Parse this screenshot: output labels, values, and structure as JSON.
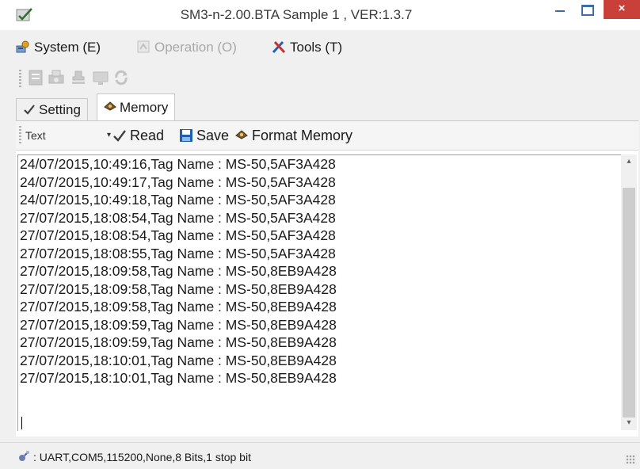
{
  "window": {
    "title": "SM3-n-2.00.BTA Sample 1 , VER:1.3.7",
    "close_glyph": "×"
  },
  "menu": {
    "items": [
      {
        "label": "System (E)",
        "icon": "system-icon",
        "enabled": true
      },
      {
        "label": "Operation (O)",
        "icon": "operation-icon",
        "enabled": false
      },
      {
        "label": "Tools (T)",
        "icon": "tools-icon",
        "enabled": true
      }
    ]
  },
  "toolbar": {
    "buttons": [
      "doc-icon",
      "print-icon",
      "stamp-icon",
      "monitor-icon",
      "refresh-icon"
    ]
  },
  "tabs": [
    {
      "label": "Setting",
      "icon": "check-icon",
      "active": false
    },
    {
      "label": "Memory",
      "icon": "memory-icon",
      "active": true
    }
  ],
  "memory_toolbar": {
    "format_select": {
      "value": "Text",
      "arrow": "▾"
    },
    "read_label": "Read",
    "save_label": "Save",
    "format_label": "Format Memory"
  },
  "memory_log": [
    "24/07/2015,10:49:16,Tag Name : MS-50,5AF3A428",
    "24/07/2015,10:49:17,Tag Name : MS-50,5AF3A428",
    "24/07/2015,10:49:18,Tag Name : MS-50,5AF3A428",
    "27/07/2015,18:08:54,Tag Name : MS-50,5AF3A428",
    "27/07/2015,18:08:54,Tag Name : MS-50,5AF3A428",
    "27/07/2015,18:08:55,Tag Name : MS-50,5AF3A428",
    "27/07/2015,18:09:58,Tag Name : MS-50,8EB9A428",
    "27/07/2015,18:09:58,Tag Name : MS-50,8EB9A428",
    "27/07/2015,18:09:58,Tag Name : MS-50,8EB9A428",
    "27/07/2015,18:09:59,Tag Name : MS-50,8EB9A428",
    "27/07/2015,18:09:59,Tag Name : MS-50,8EB9A428",
    "27/07/2015,18:10:01,Tag Name : MS-50,8EB9A428",
    "27/07/2015,18:10:01,Tag Name : MS-50,8EB9A428"
  ],
  "scrollbar": {
    "up_glyph": "▴",
    "down_glyph": "▾"
  },
  "status": {
    "text": ": UART,COM5,115200,None,8 Bits,1 stop bit",
    "icon": "connection-icon"
  },
  "colors": {
    "close_button": "#c9403a",
    "window_button": "#3b6ea8",
    "save_icon": "#1f5fb0"
  }
}
